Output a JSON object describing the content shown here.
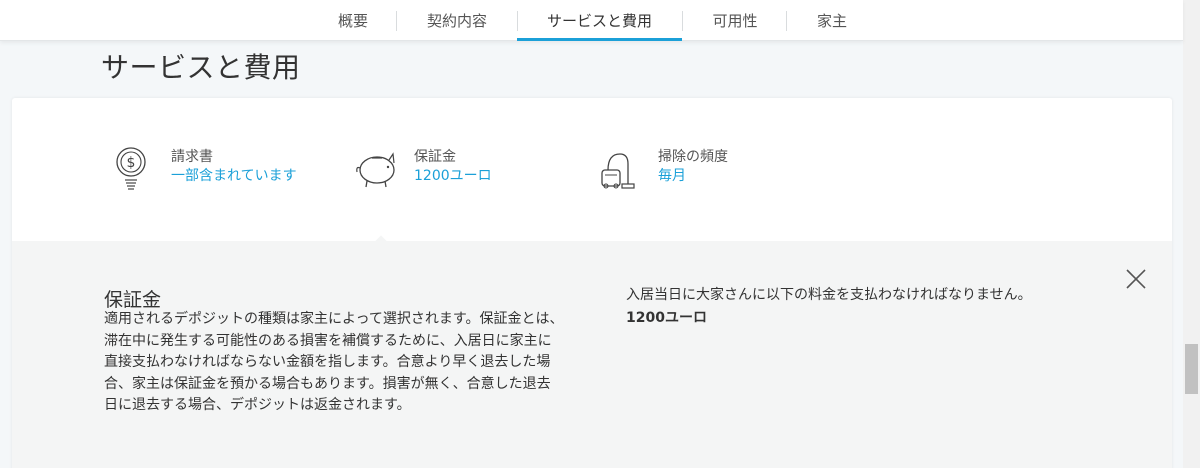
{
  "tabs": [
    {
      "label": "概要"
    },
    {
      "label": "契約内容"
    },
    {
      "label": "サービスと費用",
      "active": true
    },
    {
      "label": "可用性"
    },
    {
      "label": "家主"
    }
  ],
  "page_title": "サービスと費用",
  "features": [
    {
      "icon": "money-bulb-icon",
      "label": "請求書",
      "value": "一部含まれています"
    },
    {
      "icon": "piggy-bank-icon",
      "label": "保証金",
      "value": "1200ユーロ"
    },
    {
      "icon": "vacuum-cleaner-icon",
      "label": "掃除の頻度",
      "value": "毎月"
    }
  ],
  "detail": {
    "title": "保証金",
    "body": "適用されるデポジットの種類は家主によって選択されます。保証金とは、滞在中に発生する可能性のある損害を補償するために、入居日に家主に直接支払わなければならない金額を指します。合意より早く退去した場合、家主は保証金を預かる場合もあります。損害が無く、合意した退去日に退去する場合、デポジットは返金されます。",
    "right_text": "入居当日に大家さんに以下の料金を支払わなければなりません。",
    "right_amount": "1200ユーロ",
    "close_icon": "close-icon"
  },
  "colors": {
    "accent": "#1ba0d8",
    "background": "#f4f7f9",
    "panel": "#f4f5f5"
  }
}
